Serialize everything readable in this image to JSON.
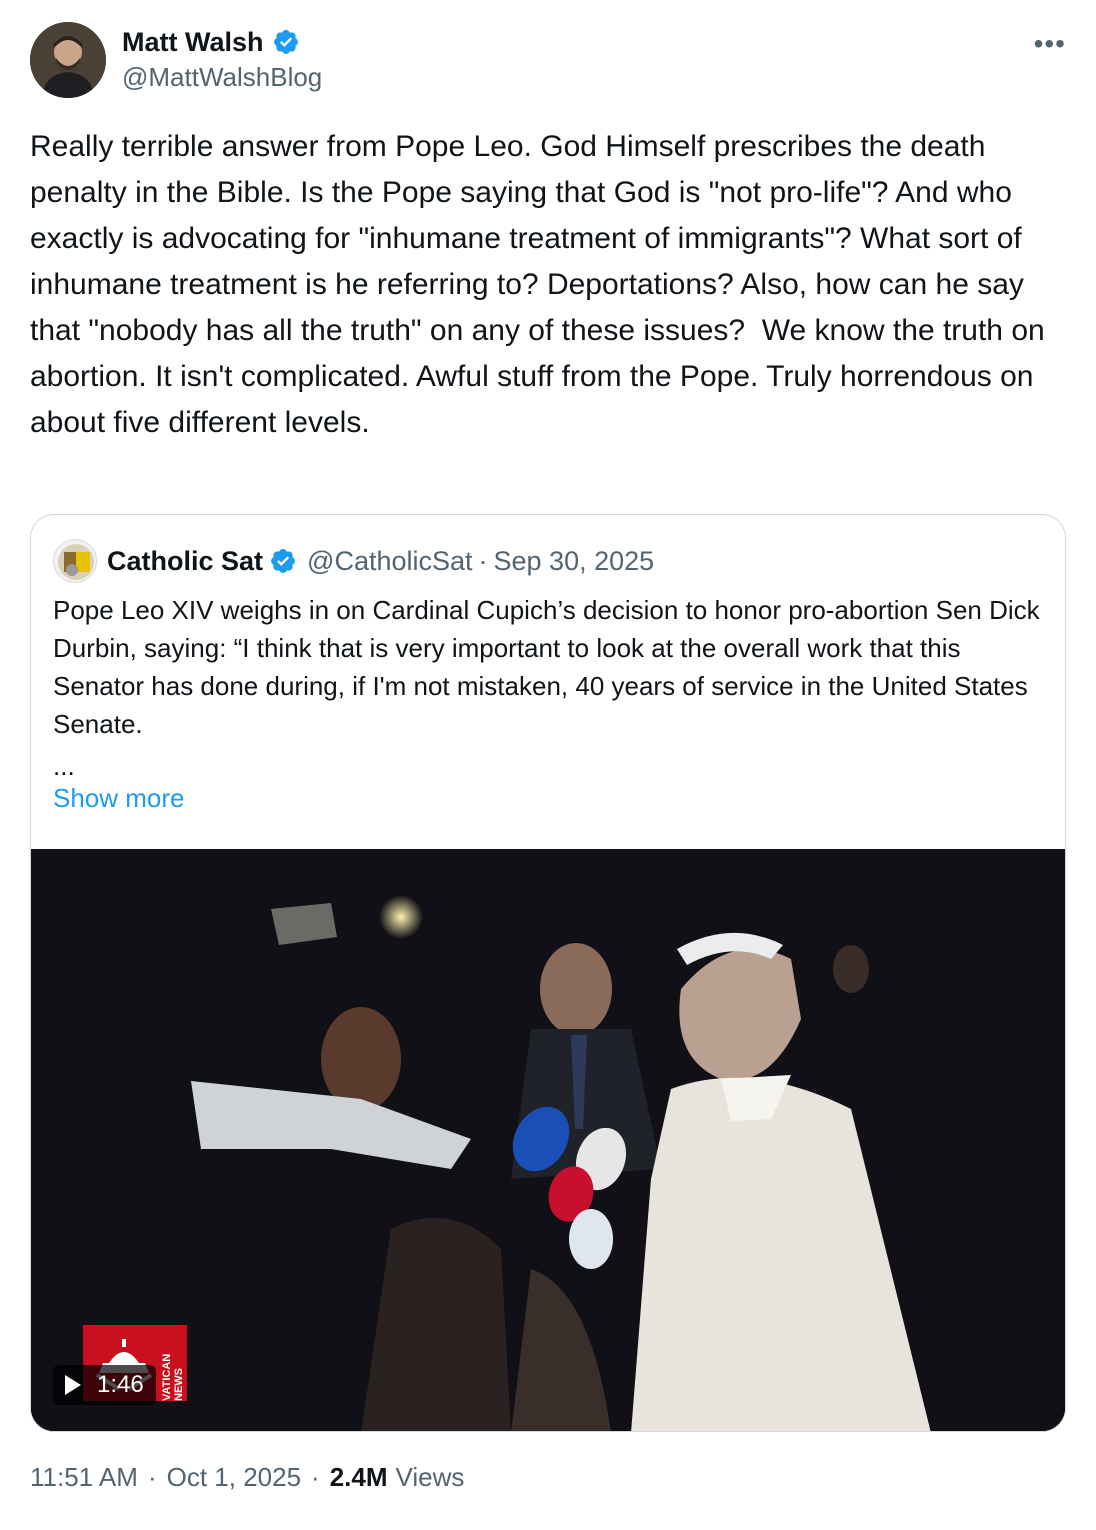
{
  "author": {
    "display_name": "Matt Walsh",
    "handle": "@MattWalshBlog",
    "verified": true
  },
  "more_icon": "more-horizontal-icon",
  "tweet": {
    "text": "Really terrible answer from Pope Leo. God Himself prescribes the death penalty in the Bible. Is the Pope saying that God is \"not pro-life\"? And who exactly is advocating for \"inhumane treatment of immigrants\"? What sort of inhumane treatment is he referring to? Deportations? Also, how can he say that \"nobody has all the truth\" on any of these issues?  We know the truth on abortion. It isn't complicated. Awful stuff from the Pope. Truly horrendous on about five different levels."
  },
  "quote": {
    "display_name": "Catholic Sat",
    "handle": "@CatholicSat",
    "separator": "·",
    "date": "Sep 30, 2025",
    "text": "Pope Leo XIV weighs in on Cardinal Cupich’s decision to honor pro-abortion Sen Dick Durbin, saying: “I think that is very important to look at the overall work that this Senator has done during, if I'm not mistaken, 40 years of service in the United States Senate.",
    "ellipsis": "...",
    "show_more": "Show more",
    "video": {
      "duration": "1:46",
      "watermark": "VATICAN NEWS"
    }
  },
  "footer": {
    "time": "11:51 AM",
    "separator": "·",
    "date": "Oct 1, 2025",
    "views_count": "2.4M",
    "views_label": "Views"
  },
  "colors": {
    "text": "#0f1419",
    "secondary": "#536471",
    "link": "#1d9bf0",
    "verified": "#1d9bf0",
    "border": "#cfd9de",
    "vatican_red": "#c8101e"
  }
}
